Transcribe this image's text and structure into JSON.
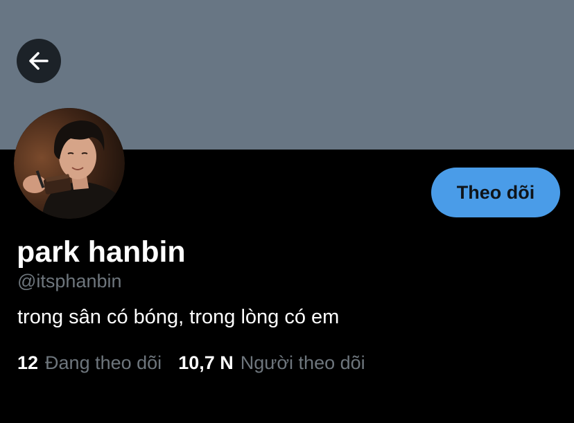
{
  "header": {
    "back_icon": "arrow-left-icon",
    "banner_color": "#687684"
  },
  "profile": {
    "avatar": "profile-photo",
    "follow_label": "Theo dõi",
    "display_name": "park hanbin",
    "handle": "@itsphanbin",
    "bio": "trong sân có bóng, trong lòng có em"
  },
  "stats": {
    "following_count": "12",
    "following_label": "Đang theo dõi",
    "followers_count": "10,7 N",
    "followers_label": "Người theo dõi"
  },
  "colors": {
    "accent": "#4a9ce8",
    "muted_text": "#6e767d",
    "background": "#000000"
  }
}
